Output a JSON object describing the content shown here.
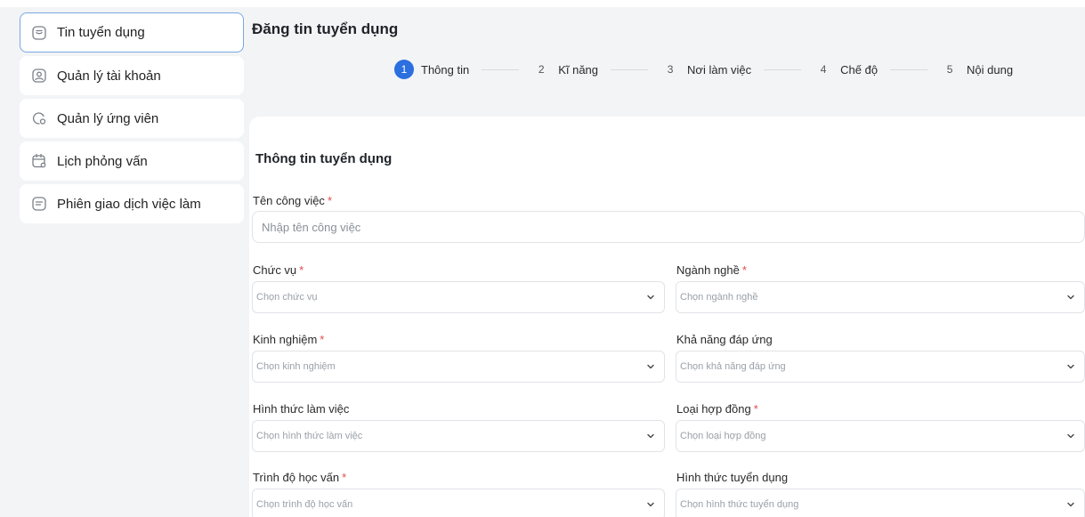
{
  "sidebar": {
    "items": [
      {
        "label": "Tin tuyển dụng",
        "icon": "job-post-icon",
        "active": true
      },
      {
        "label": "Quản lý tài khoản",
        "icon": "account-icon"
      },
      {
        "label": "Quản lý ứng viên",
        "icon": "candidate-icon"
      },
      {
        "label": "Lịch phỏng vấn",
        "icon": "calendar-icon"
      },
      {
        "label": "Phiên giao dịch việc làm",
        "icon": "job-fair-icon"
      }
    ]
  },
  "header": {
    "title": "Đăng tin tuyển dụng"
  },
  "steps": [
    {
      "num": "1",
      "label": "Thông tin",
      "active": true
    },
    {
      "num": "2",
      "label": "Kĩ năng"
    },
    {
      "num": "3",
      "label": "Nơi làm việc"
    },
    {
      "num": "4",
      "label": "Chế độ"
    },
    {
      "num": "5",
      "label": "Nội dung"
    }
  ],
  "form": {
    "section_title": "Thông tin tuyển dụng",
    "required_mark": "*",
    "job_title": {
      "label": "Tên công việc",
      "placeholder": "Nhập tên công việc",
      "value": ""
    },
    "fields": [
      {
        "label": "Chức vụ",
        "placeholder": "Chọn chức vụ",
        "required": true
      },
      {
        "label": "Ngành nghề",
        "placeholder": "Chọn ngành nghề",
        "required": true
      },
      {
        "label": "Kinh nghiệm",
        "placeholder": "Chọn kinh nghiệm",
        "required": true
      },
      {
        "label": "Khả năng đáp ứng",
        "placeholder": "Chọn khả năng đáp ứng",
        "required": false
      },
      {
        "label": "Hình thức làm việc",
        "placeholder": "Chọn hình thức làm việc",
        "required": false
      },
      {
        "label": "Loại hợp đồng",
        "placeholder": "Chọn loại hợp đồng",
        "required": true
      },
      {
        "label": "Trình độ học vấn",
        "placeholder": "Chọn trình độ học vấn",
        "required": true
      },
      {
        "label": "Hình thức tuyển dụng",
        "placeholder": "Chọn hình thức tuyển dụng",
        "required": false
      }
    ]
  },
  "colors": {
    "accent": "#2b6fe0",
    "required": "#e5484d",
    "active_border": "#7aa7e0"
  }
}
